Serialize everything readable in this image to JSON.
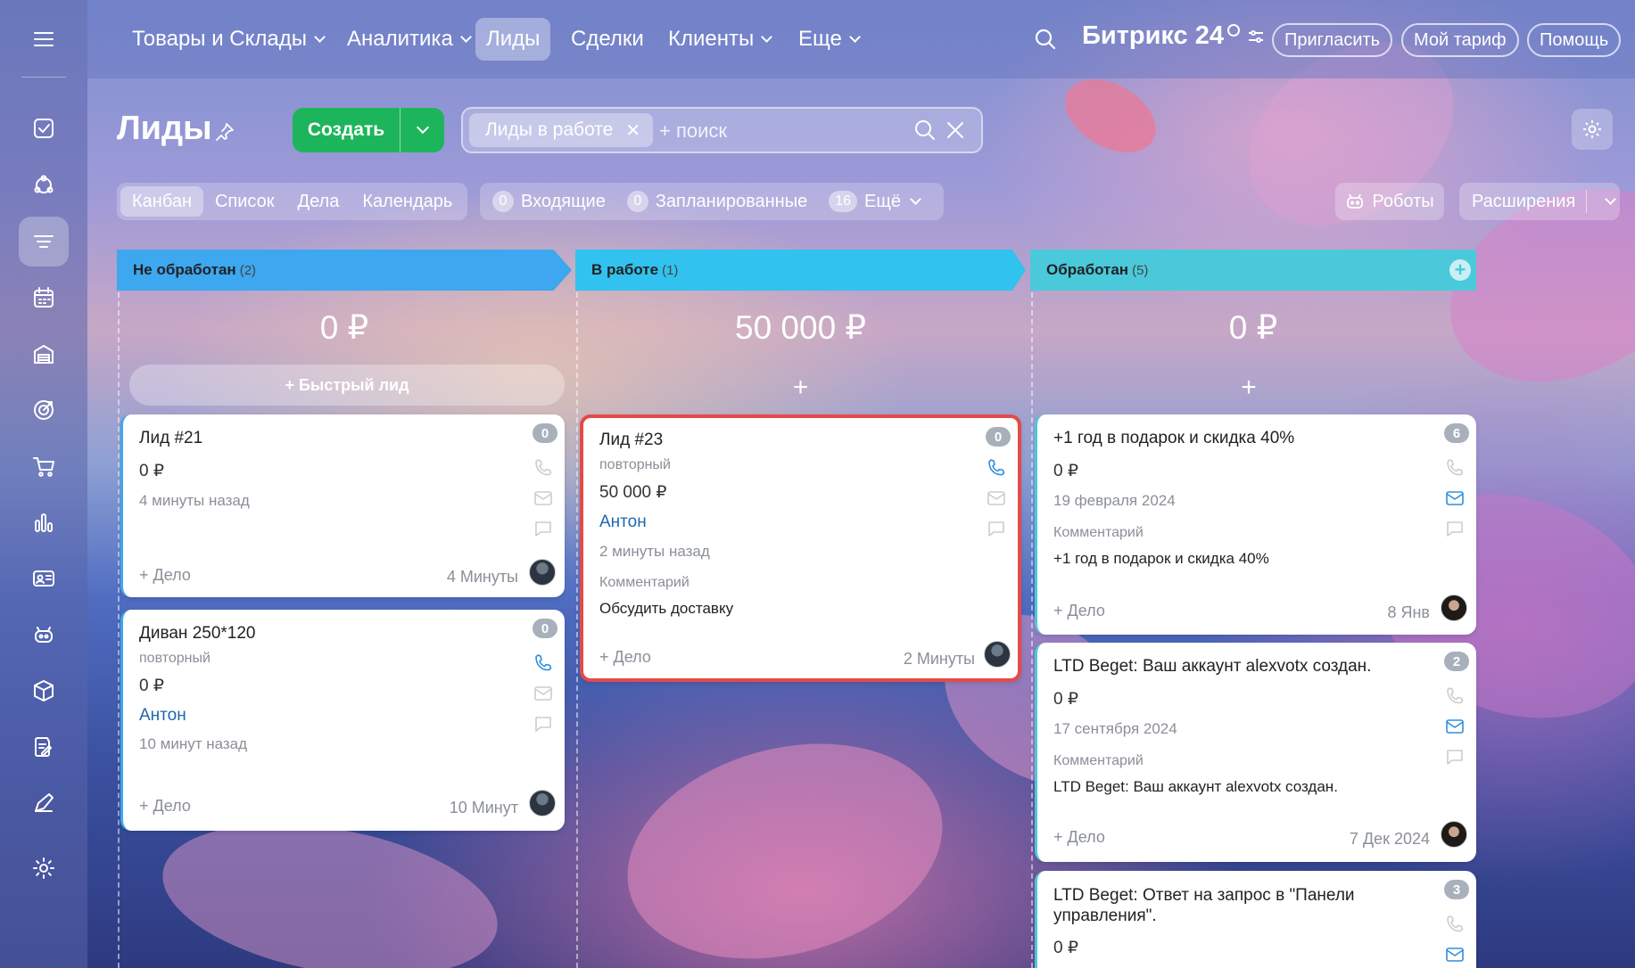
{
  "topnav": {
    "items": [
      {
        "label": "Товары и Склады",
        "chevron": true
      },
      {
        "label": "Аналитика",
        "chevron": true
      },
      {
        "label": "Лиды",
        "chevron": false,
        "active": true
      },
      {
        "label": "Сделки",
        "chevron": false
      },
      {
        "label": "Клиенты",
        "chevron": true
      },
      {
        "label": "Еще",
        "chevron": true
      }
    ],
    "brand": "Битрикс 24",
    "invite": "Пригласить",
    "tariff": "Мой тариф",
    "help": "Помощь"
  },
  "page": {
    "title": "Лиды",
    "create": "Создать",
    "filter_chip": "Лиды в работе",
    "search_placeholder": "+ поиск"
  },
  "view_tabs": [
    "Канбан",
    "Список",
    "Дела",
    "Календарь"
  ],
  "counters": [
    {
      "count": "0",
      "label": "Входящие"
    },
    {
      "count": "0",
      "label": "Запланированные"
    },
    {
      "count": "16",
      "label": "Ещё"
    }
  ],
  "robots": "Роботы",
  "extensions": "Расширения",
  "columns": [
    {
      "title": "Не обработан",
      "count": "(2)",
      "sum": "0 ₽",
      "quick": "+ Быстрый лид"
    },
    {
      "title": "В работе",
      "count": "(1)",
      "sum": "50 000 ₽",
      "plus": "+"
    },
    {
      "title": "Обработан",
      "count": "(5)",
      "sum": "0 ₽",
      "plus": "+"
    }
  ],
  "cards": {
    "lead21": {
      "title": "Лид #21",
      "money": "0 ₽",
      "time": "4 минуты назад",
      "deal": "+ Дело",
      "ago": "4 Минуты",
      "badge": "0"
    },
    "divan": {
      "title": "Диван 250*120",
      "sub": "повторный",
      "money": "0 ₽",
      "person": "Антон",
      "time": "10 минут назад",
      "deal": "+ Дело",
      "ago": "10 Минут",
      "badge": "0"
    },
    "lead23": {
      "title": "Лид #23",
      "sub": "повторный",
      "money": "50 000 ₽",
      "person": "Антон",
      "time": "2 минуты назад",
      "comment_label": "Комментарий",
      "comment": "Обсудить доставку",
      "deal": "+ Дело",
      "ago": "2 Минуты",
      "badge": "0"
    },
    "gift": {
      "title": "+1 год в подарок и скидка 40%",
      "money": "0 ₽",
      "time": "19 февраля 2024",
      "comment_label": "Комментарий",
      "comment": "+1 год в подарок и скидка 40%",
      "deal": "+ Дело",
      "ago": "8 Янв",
      "badge": "6"
    },
    "beget1": {
      "title": "LTD Beget: Ваш аккаунт alexvotx создан.",
      "money": "0 ₽",
      "time": "17 сентября 2024",
      "comment_label": "Комментарий",
      "comment": "LTD Beget: Ваш аккаунт alexvotx создан.",
      "deal": "+ Дело",
      "ago": "7 Дек 2024",
      "badge": "2"
    },
    "beget2": {
      "title_line1": "LTD Beget: Ответ на запрос в \"Панели",
      "title_line2": "управления\".",
      "money": "0 ₽",
      "badge": "3"
    }
  }
}
